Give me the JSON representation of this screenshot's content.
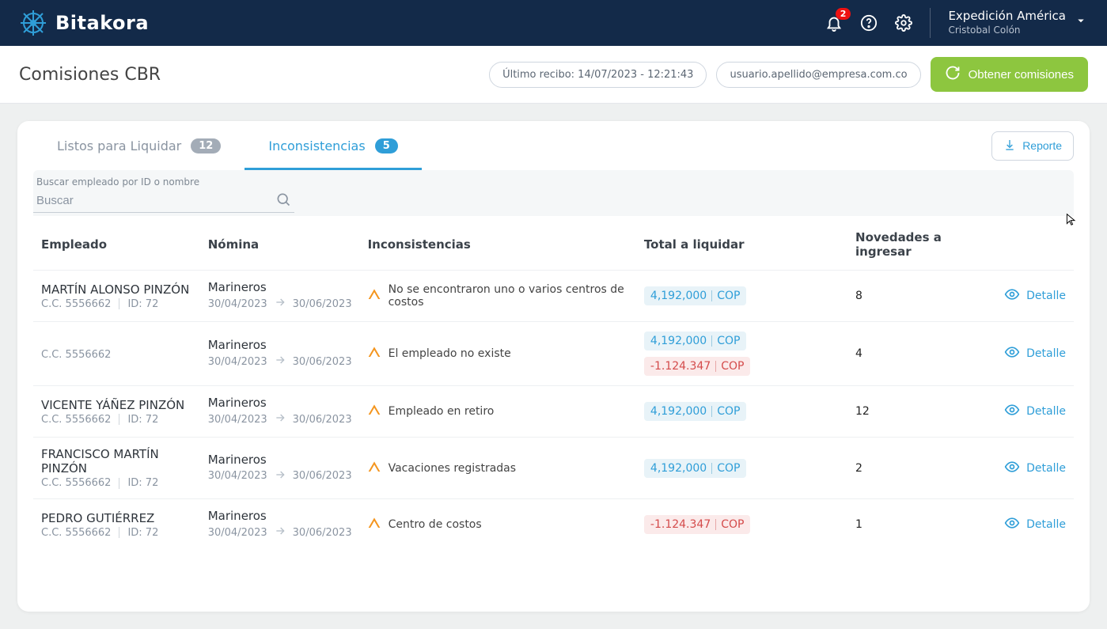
{
  "brand": "Bitakora",
  "header": {
    "notification_count": "2",
    "company": "Expedición América",
    "user": "Cristobal Colón"
  },
  "page": {
    "title": "Comisiones CBR",
    "last_receipt": "Último recibo: 14/07/2023 - 12:21:43",
    "user_email": "usuario.apellido@empresa.com.co",
    "primary_action": "Obtener comisiones"
  },
  "tabs": {
    "ready": {
      "label": "Listos para Liquidar",
      "count": "12"
    },
    "inconsistencies": {
      "label": "Inconsistencias",
      "count": "5"
    }
  },
  "report_btn": "Reporte",
  "search": {
    "label": "Buscar empleado por ID o nombre",
    "placeholder": "Buscar"
  },
  "columns": {
    "empleado": "Empleado",
    "nomina": "Nómina",
    "inconsistencias": "Inconsistencias",
    "total": "Total a liquidar",
    "novedades": "Novedades a ingresar"
  },
  "detalle_label": "Detalle",
  "id_prefix": "ID:",
  "rows": [
    {
      "name": "MARTÍN ALONSO PINZÓN",
      "cc": "C.C. 5556662",
      "id": "72",
      "group": "Marineros",
      "from": "30/04/2023",
      "to": "30/06/2023",
      "issue": "No se encontraron uno o varios centros de costos",
      "amount": "4,192,000",
      "currency": "COP",
      "neg_amount": "",
      "neg_currency": "",
      "novedades": "8"
    },
    {
      "name": "",
      "cc": "C.C. 5556662",
      "id": "",
      "group": "Marineros",
      "from": "30/04/2023",
      "to": "30/06/2023",
      "issue": "El empleado no existe",
      "amount": "4,192,000",
      "currency": "COP",
      "neg_amount": "-1.124.347",
      "neg_currency": "COP",
      "novedades": "4"
    },
    {
      "name": "VICENTE YÁÑEZ PINZÓN",
      "cc": "C.C. 5556662",
      "id": "72",
      "group": "Marineros",
      "from": "30/04/2023",
      "to": "30/06/2023",
      "issue": "Empleado en retiro",
      "amount": "4,192,000",
      "currency": "COP",
      "neg_amount": "",
      "neg_currency": "",
      "novedades": "12"
    },
    {
      "name": "FRANCISCO MARTÍN PINZÓN",
      "cc": "C.C. 5556662",
      "id": "72",
      "group": "Marineros",
      "from": "30/04/2023",
      "to": "30/06/2023",
      "issue": "Vacaciones registradas",
      "amount": "4,192,000",
      "currency": "COP",
      "neg_amount": "",
      "neg_currency": "",
      "novedades": "2"
    },
    {
      "name": "PEDRO GUTIÉRREZ",
      "cc": "C.C. 5556662",
      "id": "72",
      "group": "Marineros",
      "from": "30/04/2023",
      "to": "30/06/2023",
      "issue": "Centro de costos",
      "amount": "",
      "currency": "",
      "neg_amount": "-1.124.347",
      "neg_currency": "COP",
      "novedades": "1"
    }
  ]
}
